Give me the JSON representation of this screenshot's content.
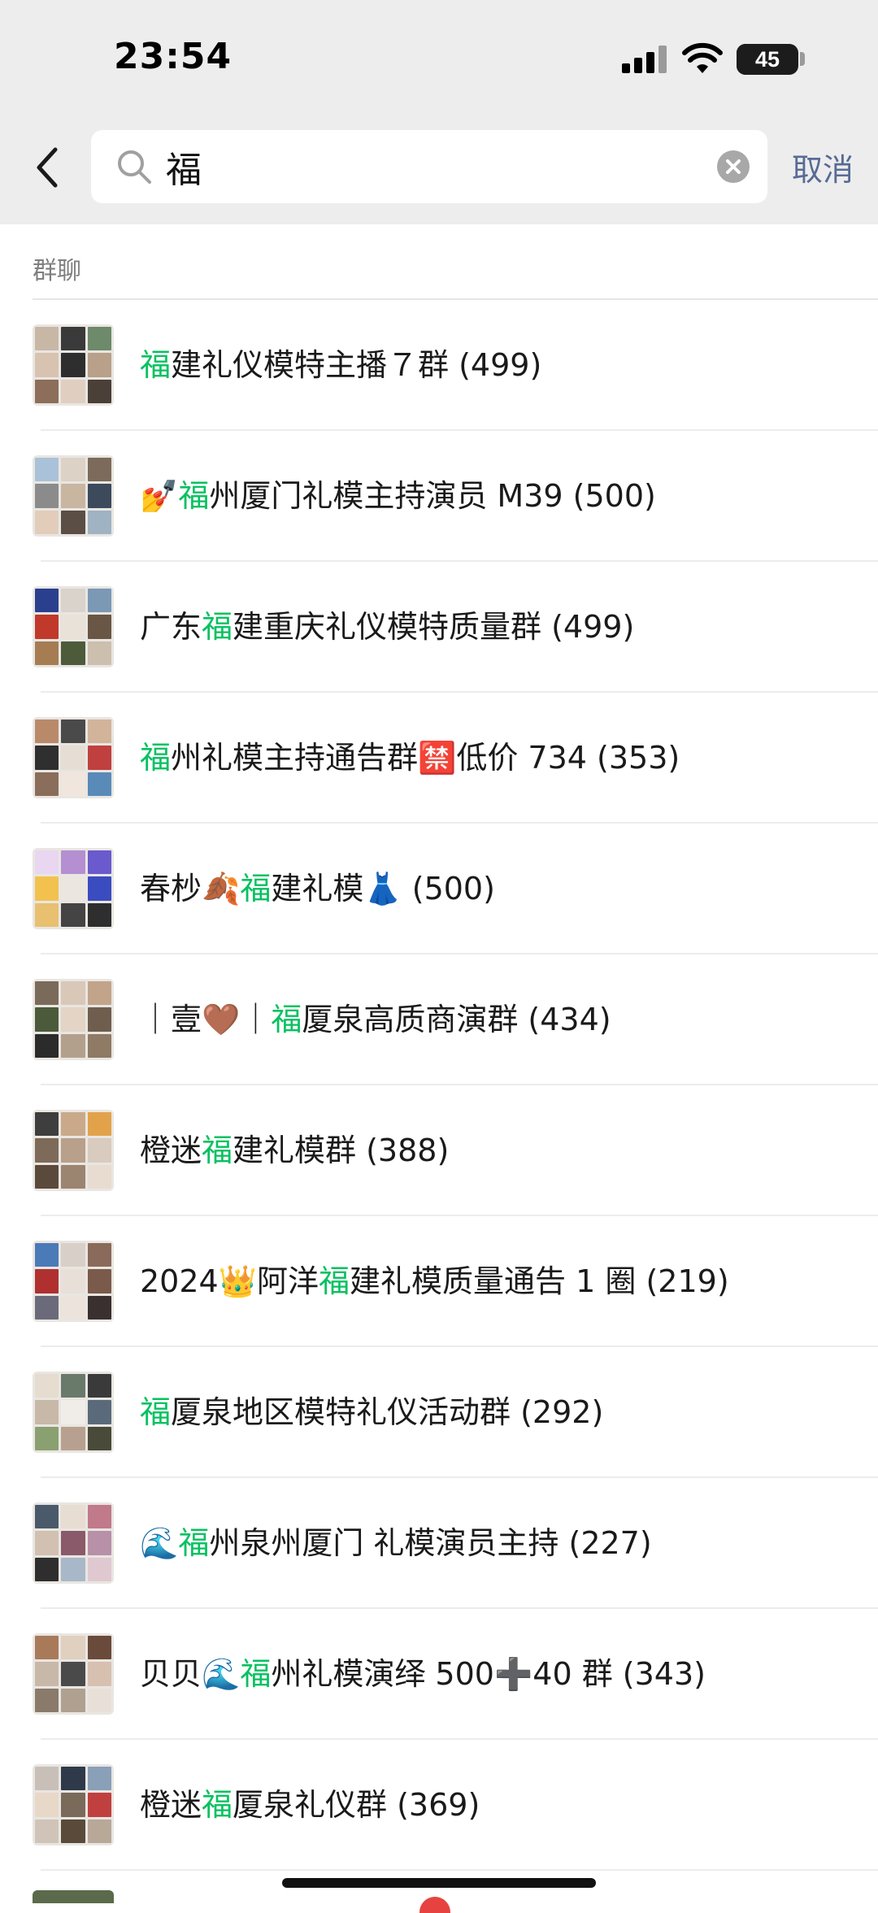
{
  "status_bar": {
    "time": "23:54",
    "battery": "45"
  },
  "search": {
    "query": "福",
    "cancel_label": "取消"
  },
  "section": {
    "title": "群聊"
  },
  "results": [
    {
      "pre": "",
      "hl": "福",
      "post": "建礼仪模特主播７群 (499)",
      "colors": [
        "#c9b7a6",
        "#3a3a3a",
        "#6d8a6a",
        "#d8c3b0",
        "#2e2e2e",
        "#b9a08a",
        "#8c6e5a",
        "#e0cfc0",
        "#4a4038"
      ]
    },
    {
      "pre": "💅",
      "hl": "福",
      "post": "州厦门礼模主持演员 M39 (500)",
      "colors": [
        "#a9c2d9",
        "#dcd3c6",
        "#7c6a5a",
        "#8b8b8b",
        "#c9b6a1",
        "#3c4a5c",
        "#e2cdbb",
        "#5b4e45",
        "#9fb3c2"
      ]
    },
    {
      "pre": "广东",
      "hl": "福",
      "post": "建重庆礼仪模特质量群 (499)",
      "colors": [
        "#2b3f8f",
        "#d9d3cc",
        "#7b98b5",
        "#c0392b",
        "#e8e2d8",
        "#6a5644",
        "#a67c52",
        "#4d5b3a",
        "#cdbfae"
      ]
    },
    {
      "pre": "",
      "hl": "福",
      "post": "州礼模主持通告群🈲低价 734 (353)",
      "colors": [
        "#b98a6a",
        "#4a4a4a",
        "#d2b49a",
        "#2f2f2f",
        "#e6ddd4",
        "#c04040",
        "#8a6d5a",
        "#f0e6dd",
        "#5a8ab8"
      ]
    },
    {
      "pre": "春杪🍂",
      "hl": "福",
      "post": "建礼模👗 (500)",
      "colors": [
        "#e9d6f0",
        "#b48fd1",
        "#6a5acd",
        "#f2c14e",
        "#ece6e0",
        "#3b4cc0",
        "#e8c070",
        "#444444",
        "#2e2e2e"
      ]
    },
    {
      "pre": "｜壹🤎｜",
      "hl": "福",
      "post": "厦泉高质商演群 (434)",
      "colors": [
        "#7a6a5a",
        "#d9c8b8",
        "#c2a48a",
        "#4a5a3a",
        "#e3d4c5",
        "#6f5e4e",
        "#2b2b2b",
        "#b3a08c",
        "#8f7a66"
      ]
    },
    {
      "pre": "橙迷",
      "hl": "福",
      "post": "建礼模群 (388)",
      "colors": [
        "#3e3e3e",
        "#c9a98a",
        "#e2a24a",
        "#7e6a58",
        "#b8a08a",
        "#d9cbbd",
        "#5a4a3c",
        "#9b8470",
        "#e8dcd0"
      ]
    },
    {
      "pre": "2024👑阿洋",
      "hl": "福",
      "post": "建礼模质量通告 1 圈 (219)",
      "colors": [
        "#4a7ab8",
        "#d8d0c8",
        "#8a6a5a",
        "#b03030",
        "#e8e0d8",
        "#7a5a4a",
        "#6a6a7a",
        "#ece4dc",
        "#3a3030"
      ]
    },
    {
      "pre": "",
      "hl": "福",
      "post": "厦泉地区模特礼仪活动群 (292)",
      "colors": [
        "#e6dccf",
        "#6a7a6a",
        "#3a3a3a",
        "#c8b8a8",
        "#f0ece8",
        "#5a6a7a",
        "#8aa070",
        "#b8a090",
        "#4a4a3a"
      ]
    },
    {
      "pre": "🌊",
      "hl": "福",
      "post": "州泉州厦门 礼模演员主持 (227)",
      "colors": [
        "#4a5a6a",
        "#e8ddd2",
        "#c07a8a",
        "#d2c0b0",
        "#8a5a6a",
        "#b890a8",
        "#2e2e2e",
        "#a8b8c8",
        "#e0c8d0"
      ]
    },
    {
      "pre": "贝贝🌊",
      "hl": "福",
      "post": "州礼模演绎 500➕40 群 (343)",
      "colors": [
        "#a87a5a",
        "#e0d0c0",
        "#6a4a3a",
        "#c8b8a8",
        "#4a4a4a",
        "#d8c0b0",
        "#8a7a6a",
        "#b0a090",
        "#e8e0d8"
      ]
    },
    {
      "pre": "橙迷",
      "hl": "福",
      "post": "厦泉礼仪群 (369)",
      "colors": [
        "#c8c0b8",
        "#2e3a4a",
        "#8aa0b8",
        "#e8d8c8",
        "#7a6a5a",
        "#c04040",
        "#d0c4b8",
        "#5a4a3a",
        "#b8a898"
      ]
    }
  ]
}
